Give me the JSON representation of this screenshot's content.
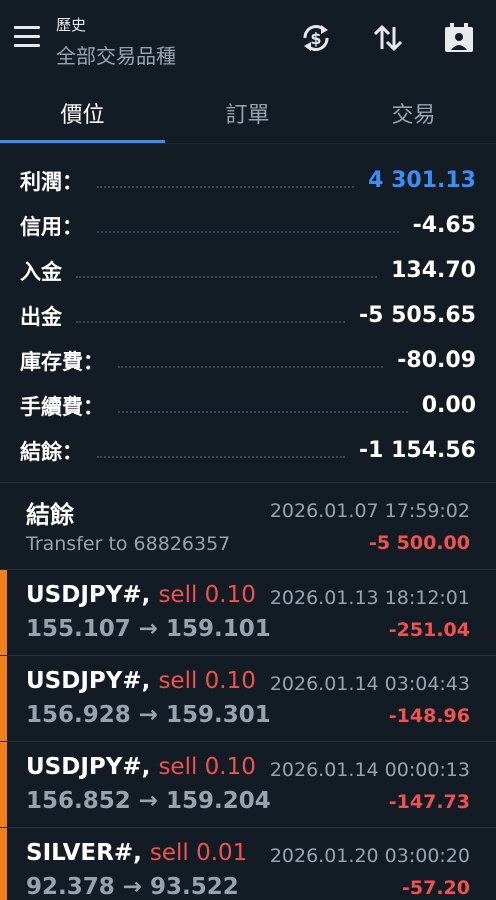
{
  "header": {
    "title": "歷史",
    "subtitle": "全部交易品種"
  },
  "icons": {
    "menu": "hamburger-menu-icon",
    "sync": "sync-dollar-icon",
    "sort": "sort-arrows-icon",
    "calendar": "calendar-person-icon"
  },
  "tabs": [
    {
      "label": "價位",
      "active": true
    },
    {
      "label": "訂單",
      "active": false
    },
    {
      "label": "交易",
      "active": false
    }
  ],
  "summary": [
    {
      "label": "利潤：",
      "value": "4 301.13",
      "highlight": true
    },
    {
      "label": "信用：",
      "value": "-4.65",
      "highlight": false
    },
    {
      "label": "入金",
      "value": "134.70",
      "highlight": false
    },
    {
      "label": "出金",
      "value": "-5 505.65",
      "highlight": false
    },
    {
      "label": "庫存費：",
      "value": "-80.09",
      "highlight": false
    },
    {
      "label": "手續費：",
      "value": "0.00",
      "highlight": false
    },
    {
      "label": "結餘：",
      "value": "-1 154.56",
      "highlight": false
    }
  ],
  "balance_entry": {
    "title": "結餘",
    "comment": "Transfer to 68826357",
    "datetime": "2026.01.07 17:59:02",
    "amount": "-5 500.00"
  },
  "deals": [
    {
      "symbol": "USDJPY#,",
      "side": "sell 0.10",
      "prices": "155.107 → 159.101",
      "datetime": "2026.01.13 18:12:01",
      "profit": "-251.04"
    },
    {
      "symbol": "USDJPY#,",
      "side": "sell 0.10",
      "prices": "156.928 → 159.301",
      "datetime": "2026.01.14 03:04:43",
      "profit": "-148.96"
    },
    {
      "symbol": "USDJPY#,",
      "side": "sell 0.10",
      "prices": "156.852 → 159.204",
      "datetime": "2026.01.14 00:00:13",
      "profit": "-147.73"
    },
    {
      "symbol": "SILVER#,",
      "side": "sell 0.01",
      "prices": "92.378 → 93.522",
      "datetime": "2026.01.20 03:00:20",
      "profit": "-57.20"
    }
  ],
  "colors": {
    "background": "#131b25",
    "accent_blue": "#3d8df5",
    "loss_red": "#ef5350",
    "position_orange": "#ef7f1a"
  }
}
